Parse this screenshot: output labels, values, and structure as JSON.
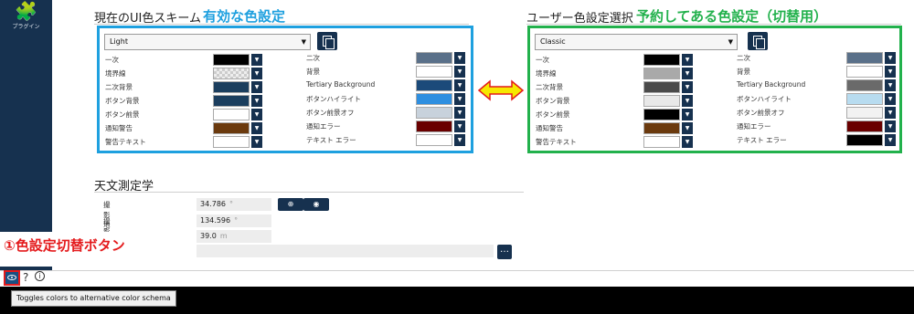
{
  "sidebar": {
    "plugin_label": "プラグイン",
    "plugin_icon": "puzzle-icon"
  },
  "current_scheme": {
    "title": "現在のUI色スキーム",
    "annotation": "有効な色設定",
    "dropdown_value": "Light",
    "left_rows": [
      {
        "label": "一次",
        "color": "#000000"
      },
      {
        "label": "境界線",
        "color": "checker"
      },
      {
        "label": "二次背景",
        "color": "#1b3e5e"
      },
      {
        "label": "ボタン背景",
        "color": "#1b3e5e"
      },
      {
        "label": "ボタン前景",
        "color": "#ffffff"
      },
      {
        "label": "通知警告",
        "color": "#6b3a0e"
      },
      {
        "label": "警告テキスト",
        "color": "#ffffff"
      }
    ],
    "right_rows": [
      {
        "label": "二次",
        "color": "#5a7089"
      },
      {
        "label": "背景",
        "color": "#ffffff"
      },
      {
        "label": "Tertiary Background",
        "color": "#1b4a7a"
      },
      {
        "label": "ボタンハイライト",
        "color": "#2e8fe0"
      },
      {
        "label": "ボタン前景オフ",
        "color": "#c8d2dc"
      },
      {
        "label": "通知エラー",
        "color": "#6a0000"
      },
      {
        "label": "テキスト エラー",
        "color": "#ffffff"
      }
    ]
  },
  "user_scheme": {
    "title": "ユーザー色設定選択",
    "annotation": "予約してある色設定（切替用）",
    "dropdown_value": "Classic",
    "left_rows": [
      {
        "label": "一次",
        "color": "#000000"
      },
      {
        "label": "境界線",
        "color": "#a9a9a9"
      },
      {
        "label": "二次背景",
        "color": "#4a4a4a"
      },
      {
        "label": "ボタン背景",
        "color": "#e8e8e8"
      },
      {
        "label": "ボタン前景",
        "color": "#000000"
      },
      {
        "label": "通知警告",
        "color": "#6b3a0e"
      },
      {
        "label": "警告テキスト",
        "color": "#ffffff"
      }
    ],
    "right_rows": [
      {
        "label": "二次",
        "color": "#5a7089"
      },
      {
        "label": "背景",
        "color": "#ffffff"
      },
      {
        "label": "Tertiary Background",
        "color": "#6a6a6a"
      },
      {
        "label": "ボタンハイライト",
        "color": "#b8dcf0"
      },
      {
        "label": "ボタン前景オフ",
        "color": "#f2f2f2"
      },
      {
        "label": "通知エラー",
        "color": "#6a0000"
      },
      {
        "label": "テキスト エラー",
        "color": "#000000"
      }
    ]
  },
  "astronomy": {
    "title": "天文測定学",
    "latitude_label": "撮影地緯度",
    "latitude_value": "34.786",
    "latitude_unit": "°",
    "longitude_label": "撮影地経度",
    "longitude_value": "134.596",
    "longitude_unit": "°",
    "elevation_value": "39.0",
    "elevation_unit": "m"
  },
  "toggle_annotation": "①色設定切替ボタン",
  "tooltip": "Toggles colors to alternative color schema",
  "colors": {
    "sidebar": "#16314f",
    "blue_frame": "#1ea0df",
    "green_frame": "#22b14c",
    "red": "#e41a1c"
  }
}
